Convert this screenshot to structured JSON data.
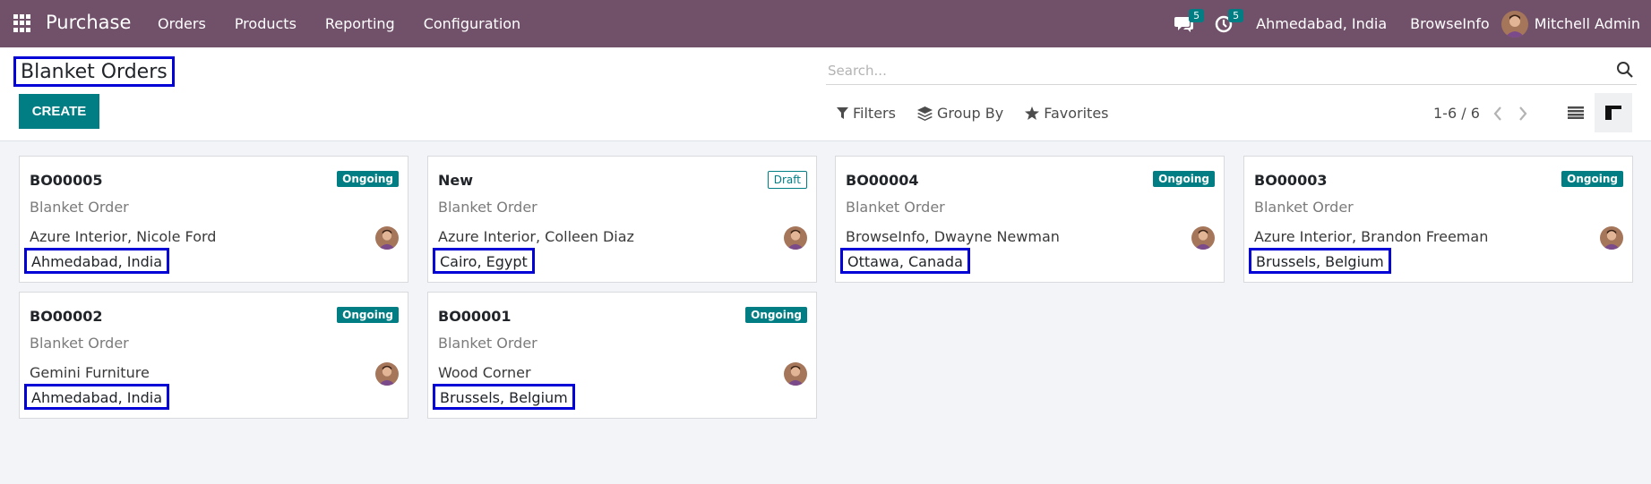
{
  "navbar": {
    "app_title": "Purchase",
    "menu": [
      "Orders",
      "Products",
      "Reporting",
      "Configuration"
    ],
    "messages_count": "5",
    "activities_count": "5",
    "company_location": "Ahmedabad, India",
    "company": "BrowseInfo",
    "user": "Mitchell Admin"
  },
  "page": {
    "title": "Blanket Orders",
    "create_label": "CREATE",
    "search_placeholder": "Search...",
    "filters_label": "Filters",
    "group_by_label": "Group By",
    "favorites_label": "Favorites",
    "pager": "1-6 / 6"
  },
  "colors": {
    "navbar": "#71506a",
    "primary": "#017e84",
    "highlight_border": "#0000d6"
  },
  "cards": [
    {
      "ref": "BO00005",
      "type": "Blanket Order",
      "partner": "Azure Interior, Nicole Ford",
      "location": "Ahmedabad, India",
      "status": "Ongoing"
    },
    {
      "ref": "New",
      "type": "Blanket Order",
      "partner": "Azure Interior, Colleen Diaz",
      "location": "Cairo, Egypt",
      "status": "Draft"
    },
    {
      "ref": "BO00004",
      "type": "Blanket Order",
      "partner": "BrowseInfo, Dwayne Newman",
      "location": "Ottawa, Canada",
      "status": "Ongoing"
    },
    {
      "ref": "BO00003",
      "type": "Blanket Order",
      "partner": "Azure Interior, Brandon Freeman",
      "location": "Brussels, Belgium",
      "status": "Ongoing"
    },
    {
      "ref": "BO00002",
      "type": "Blanket Order",
      "partner": "Gemini Furniture",
      "location": "Ahmedabad, India",
      "status": "Ongoing"
    },
    {
      "ref": "BO00001",
      "type": "Blanket Order",
      "partner": "Wood Corner",
      "location": "Brussels, Belgium",
      "status": "Ongoing"
    }
  ]
}
